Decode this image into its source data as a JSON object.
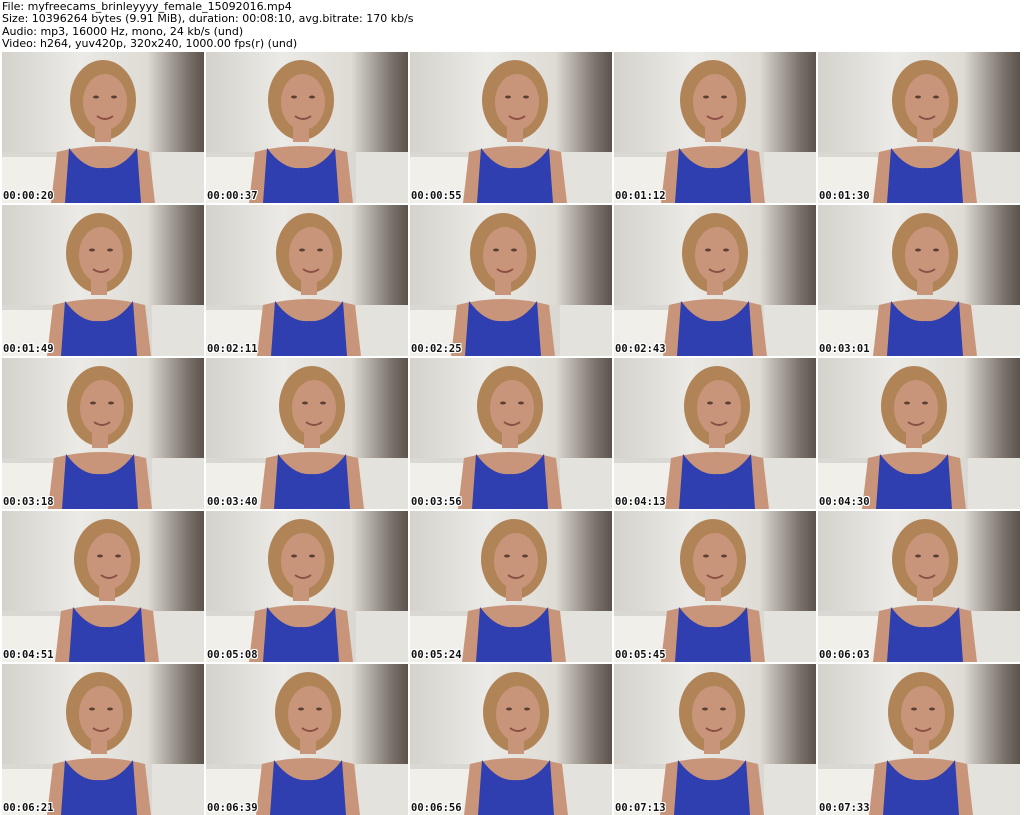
{
  "info": {
    "file": "File: myfreecams_brinleyyyy_female_15092016.mp4",
    "size": "Size: 10396264 bytes (9.91 MiB), duration: 00:08:10, avg.bitrate: 170 kb/s",
    "audio": "Audio: mp3, 16000 Hz, mono, 24 kb/s (und)",
    "video": "Video: h264, yuv420p, 320x240, 1000.00 fps(r) (und)"
  },
  "colors": {
    "wall": "#e6e4df",
    "top_blue": "#2f3fb0",
    "skin": "#c9957a",
    "hair": "#b08457"
  },
  "frames": [
    {
      "timestamp": "00:00:20"
    },
    {
      "timestamp": "00:00:37"
    },
    {
      "timestamp": "00:00:55"
    },
    {
      "timestamp": "00:01:12"
    },
    {
      "timestamp": "00:01:30"
    },
    {
      "timestamp": "00:01:49"
    },
    {
      "timestamp": "00:02:11"
    },
    {
      "timestamp": "00:02:25"
    },
    {
      "timestamp": "00:02:43"
    },
    {
      "timestamp": "00:03:01"
    },
    {
      "timestamp": "00:03:18"
    },
    {
      "timestamp": "00:03:40"
    },
    {
      "timestamp": "00:03:56"
    },
    {
      "timestamp": "00:04:13"
    },
    {
      "timestamp": "00:04:30"
    },
    {
      "timestamp": "00:04:51"
    },
    {
      "timestamp": "00:05:08"
    },
    {
      "timestamp": "00:05:24"
    },
    {
      "timestamp": "00:05:45"
    },
    {
      "timestamp": "00:06:03"
    },
    {
      "timestamp": "00:06:21"
    },
    {
      "timestamp": "00:06:39"
    },
    {
      "timestamp": "00:06:56"
    },
    {
      "timestamp": "00:07:13"
    },
    {
      "timestamp": "00:07:33"
    }
  ]
}
